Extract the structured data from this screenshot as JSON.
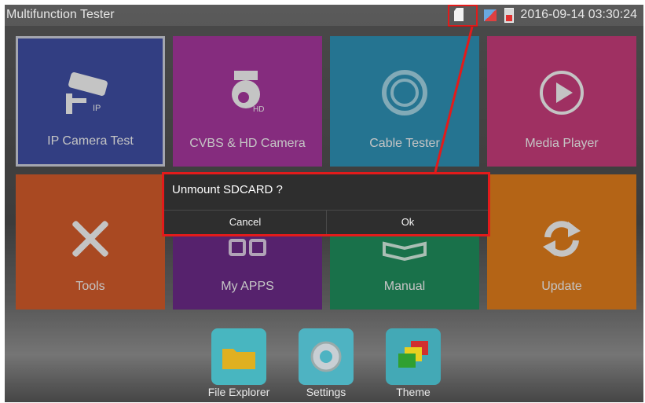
{
  "statusbar": {
    "title": "Multifunction Tester",
    "datetime": "2016-09-14 03:30:24",
    "icons": [
      "sdcard-icon",
      "network-icon",
      "battery-icon"
    ]
  },
  "tiles": [
    {
      "label": "IP Camera Test",
      "icon": "ip-camera-icon",
      "color": "#3d4c9f"
    },
    {
      "label": "CVBS & HD Camera",
      "icon": "ptz-camera-icon",
      "color": "#a3369a"
    },
    {
      "label": "Cable Tester",
      "icon": "cable-icon",
      "color": "#2e8eb1"
    },
    {
      "label": "Media Player",
      "icon": "play-icon",
      "color": "#c23b78"
    },
    {
      "label": "Tools",
      "icon": "tools-icon",
      "color": "#cf5a2a"
    },
    {
      "label": "My APPS",
      "icon": "apps-icon",
      "color": "#6a2a86"
    },
    {
      "label": "Manual",
      "icon": "book-icon",
      "color": "#1f8a5b"
    },
    {
      "label": "Update",
      "icon": "refresh-icon",
      "color": "#dc7a1b"
    }
  ],
  "dialog": {
    "message": "Unmount SDCARD ?",
    "cancel_label": "Cancel",
    "ok_label": "Ok"
  },
  "dock": [
    {
      "label": "File Explorer",
      "icon": "folder-icon"
    },
    {
      "label": "Settings",
      "icon": "settings-gear-icon"
    },
    {
      "label": "Theme",
      "icon": "theme-icon"
    }
  ],
  "highlight_color": "#e21b1b"
}
